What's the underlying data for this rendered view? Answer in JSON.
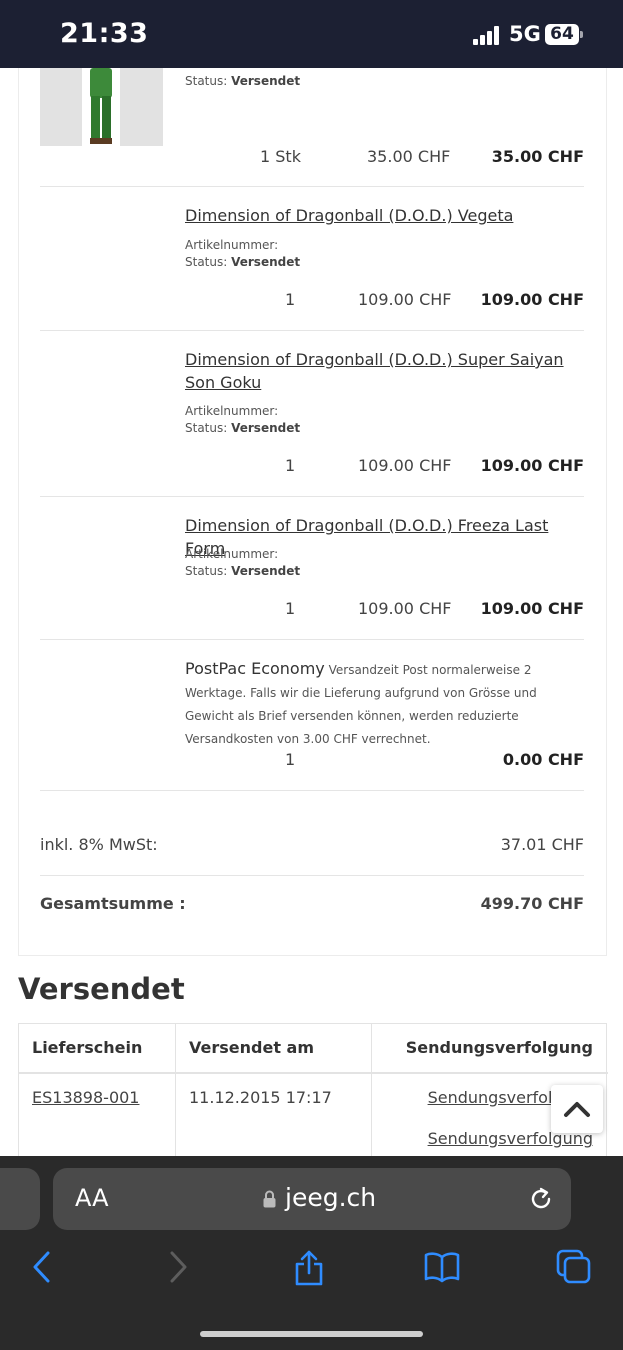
{
  "status_bar": {
    "time": "21:33",
    "network": "5G",
    "battery": "64"
  },
  "items": [
    {
      "status_label": "Status:",
      "status": "Versendet",
      "qty": "1 Stk",
      "unit_price": "35.00 CHF",
      "total": "35.00 CHF"
    },
    {
      "title": "Dimension of Dragonball (D.O.D.) Vegeta",
      "sku_label": "Artikelnummer:",
      "status_label": "Status:",
      "status": "Versendet",
      "qty": "1",
      "unit_price": "109.00 CHF",
      "total": "109.00 CHF"
    },
    {
      "title": "Dimension of Dragonball (D.O.D.) Super Saiyan Son Goku",
      "sku_label": "Artikelnummer:",
      "status_label": "Status:",
      "status": "Versendet",
      "qty": "1",
      "unit_price": "109.00 CHF",
      "total": "109.00 CHF"
    },
    {
      "title": "Dimension of Dragonball (D.O.D.) Freeza Last Form",
      "sku_label": "Artikelnummer:",
      "status_label": "Status:",
      "status": "Versendet",
      "qty": "1",
      "unit_price": "109.00 CHF",
      "total": "109.00 CHF"
    }
  ],
  "shipping": {
    "name": "PostPac Economy",
    "description": "Versandzeit Post normalerweise 2 Werktage. Falls wir die Lieferung aufgrund von Grösse und Gewicht als Brief versenden können, werden reduzierte Versandkosten von 3.00 CHF verrechnet.",
    "qty": "1",
    "total": "0.00 CHF"
  },
  "summary": {
    "vat_label": "inkl. 8% MwSt:",
    "vat_value": "37.01 CHF",
    "total_label": "Gesamtsumme :",
    "total_value": "499.70 CHF"
  },
  "shipment_section": {
    "title": "Versendet",
    "headers": [
      "Lieferschein",
      "Versendet am",
      "Sendungsverfolgung"
    ],
    "row": {
      "delivery_note": "ES13898-001",
      "shipped_at": "11.12.2015 17:17",
      "tracking_1": "Sendungsverfolgung",
      "tracking_2": "Sendungsverfolgung"
    }
  },
  "browser": {
    "text_size": "AA",
    "domain": "jeeg.ch"
  }
}
